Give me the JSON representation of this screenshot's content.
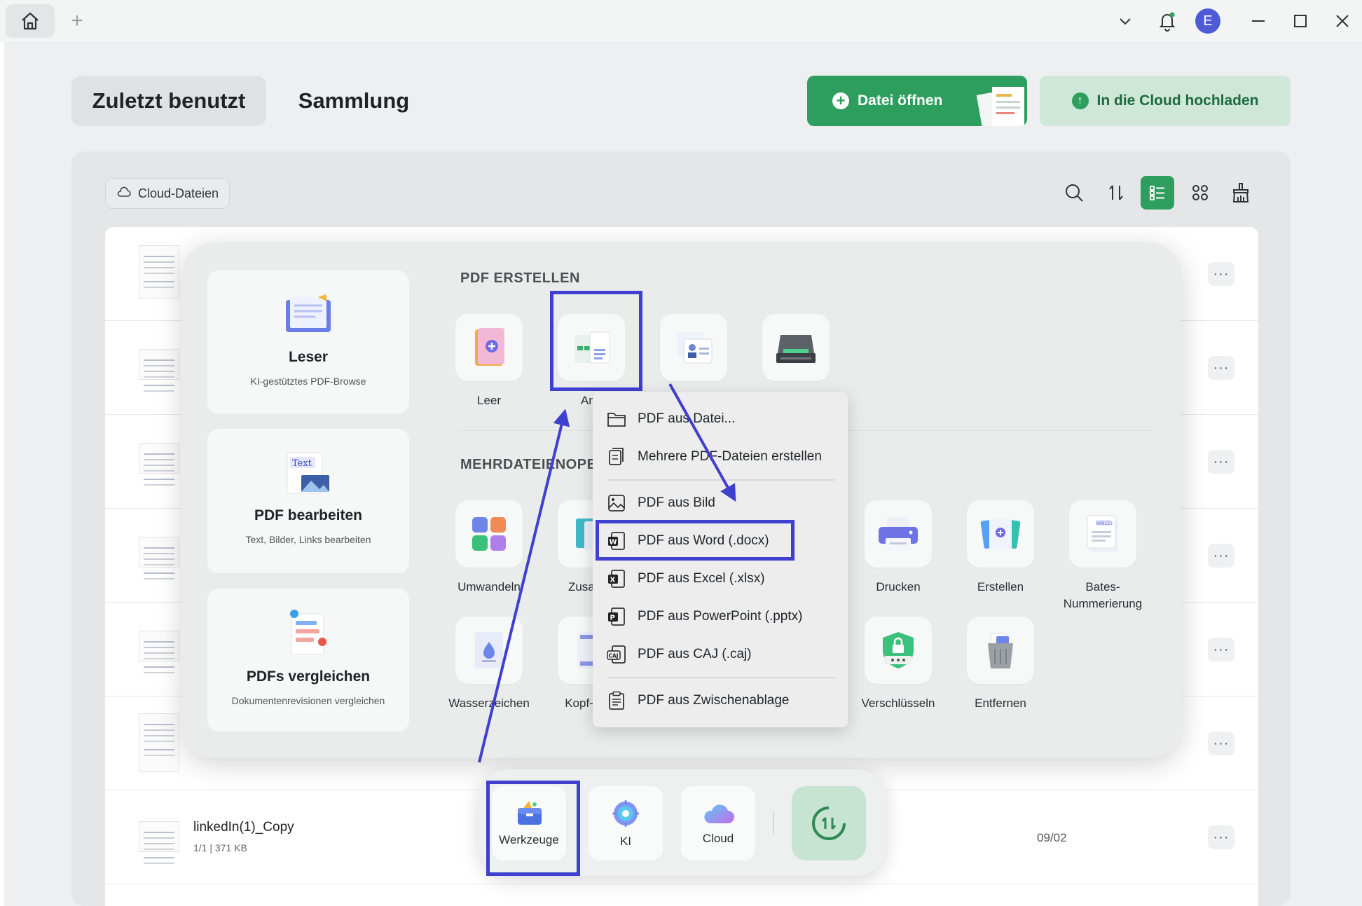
{
  "titlebar": {
    "avatar_letter": "E",
    "icons": [
      "home-icon",
      "add-tab-icon",
      "chevron-down-icon",
      "bell-icon",
      "minimize-icon",
      "maximize-icon",
      "close-icon"
    ]
  },
  "tabs": {
    "recent": "Zuletzt benutzt",
    "collection": "Sammlung"
  },
  "actions": {
    "open_file": "Datei öffnen",
    "upload_cloud": "In die Cloud hochladen"
  },
  "cloud_files_label": "Cloud-Dateien",
  "files": [
    {
      "name": "linkedIn(1)_Copy",
      "meta": "1/1 | 371 KB",
      "date": "09/02"
    }
  ],
  "tools_overlay": {
    "cards": [
      {
        "title": "Leser",
        "subtitle": "KI-gestütztes PDF-Browse"
      },
      {
        "title": "PDF bearbeiten",
        "subtitle": "Text, Bilder, Links bearbeiten"
      },
      {
        "title": "PDFs vergleichen",
        "subtitle": "Dokumentenrevisionen vergleichen"
      }
    ],
    "section_create": "PDF ERSTELLEN",
    "section_multi": "MEHRDATEIENOPE",
    "create_tools": [
      "Leer",
      "And",
      "",
      ""
    ],
    "multi_tools_row1": [
      "Umwandeln",
      "Zusamm",
      "Drucken",
      "Erstellen",
      "Bates-Nummerierung"
    ],
    "multi_tools_row2": [
      "Wasserzeichen",
      "Kopf- Fuß",
      "Verschlüsseln",
      "Entfernen"
    ]
  },
  "dropdown": {
    "items": [
      "PDF aus Datei...",
      "Mehrere PDF-Dateien erstellen",
      "PDF aus Bild",
      "PDF aus Word (.docx)",
      "PDF aus Excel (.xlsx)",
      "PDF aus PowerPoint (.pptx)",
      "PDF aus CAJ (.caj)",
      "PDF aus Zwischenablage"
    ]
  },
  "dock": {
    "tools": "Werkzeuge",
    "ai": "KI",
    "cloud": "Cloud"
  },
  "colors": {
    "accent_green": "#2e9e5e",
    "highlight": "#3f3fd0",
    "avatar": "#4f5bd5"
  }
}
